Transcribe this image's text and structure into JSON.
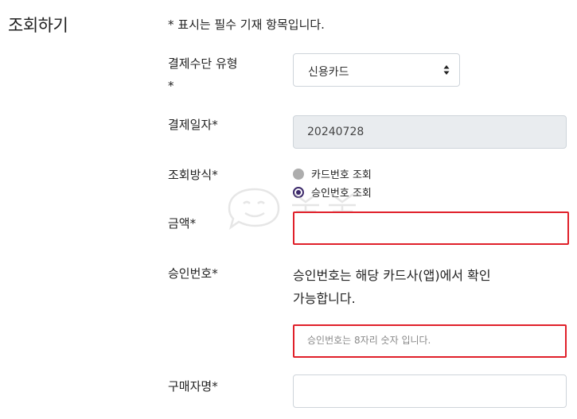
{
  "page": {
    "title": "조회하기",
    "required_note": "* 표시는 필수 기재 항목입니다."
  },
  "payment_method": {
    "label_line1": "결제수단 유형",
    "label_line2": "*",
    "selected": "신용카드"
  },
  "payment_date": {
    "label": "결제일자*",
    "value": "20240728"
  },
  "lookup_method": {
    "label": "조회방식*",
    "options": [
      {
        "label": "카드번호 조회",
        "selected": false
      },
      {
        "label": "승인번호 조회",
        "selected": true
      }
    ]
  },
  "amount": {
    "label": "금액*",
    "value": ""
  },
  "approval": {
    "label": "승인번호*",
    "help_line1": "승인번호는 해당 카드사(앱)에서 확인",
    "help_line2": "가능합니다.",
    "placeholder": "승인번호는 8자리 숫자 입니다."
  },
  "buyer": {
    "label": "구매자명*",
    "value": ""
  },
  "colors": {
    "highlight": "#e0202a",
    "radio_accent": "#3d2a6b"
  },
  "icons": {
    "select_arrows": "updown-arrows-icon",
    "watermark": "watermark-logo"
  }
}
